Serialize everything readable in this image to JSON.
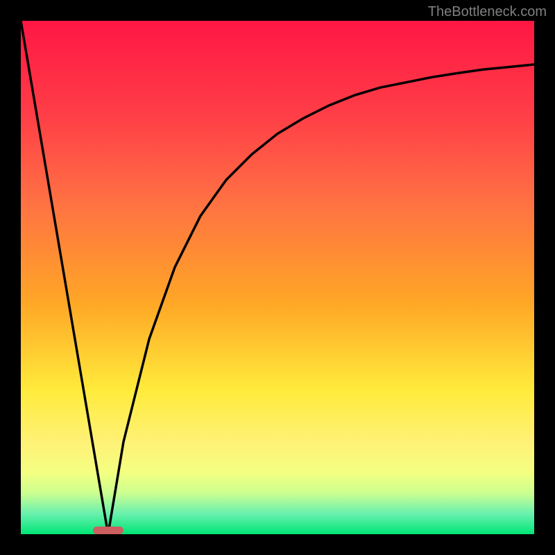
{
  "watermark": "TheBottleneck.com",
  "chart_data": {
    "type": "line",
    "title": "",
    "xlabel": "",
    "ylabel": "",
    "xlim": [
      0,
      100
    ],
    "ylim": [
      0,
      100
    ],
    "series": [
      {
        "name": "left-descent",
        "x": [
          0,
          17
        ],
        "values": [
          100,
          0
        ]
      },
      {
        "name": "right-ascent",
        "x": [
          17,
          20,
          25,
          30,
          35,
          40,
          45,
          50,
          55,
          60,
          65,
          70,
          75,
          80,
          85,
          90,
          95,
          100
        ],
        "values": [
          0,
          18,
          38,
          52,
          62,
          69,
          74,
          78,
          81,
          83.5,
          85.5,
          87,
          88,
          89,
          89.8,
          90.5,
          91,
          91.5
        ]
      }
    ],
    "marker": {
      "x": 17,
      "y": 0,
      "width": 6,
      "height": 1.5
    },
    "gradient_stops": [
      {
        "offset": 0,
        "color": "#ff1744"
      },
      {
        "offset": 18,
        "color": "#ff3d47"
      },
      {
        "offset": 35,
        "color": "#ff7043"
      },
      {
        "offset": 55,
        "color": "#ffa726"
      },
      {
        "offset": 72,
        "color": "#ffeb3b"
      },
      {
        "offset": 82,
        "color": "#fff176"
      },
      {
        "offset": 88,
        "color": "#f4ff81"
      },
      {
        "offset": 92,
        "color": "#ccff90"
      },
      {
        "offset": 96,
        "color": "#69f0ae"
      },
      {
        "offset": 100,
        "color": "#00e676"
      }
    ]
  }
}
